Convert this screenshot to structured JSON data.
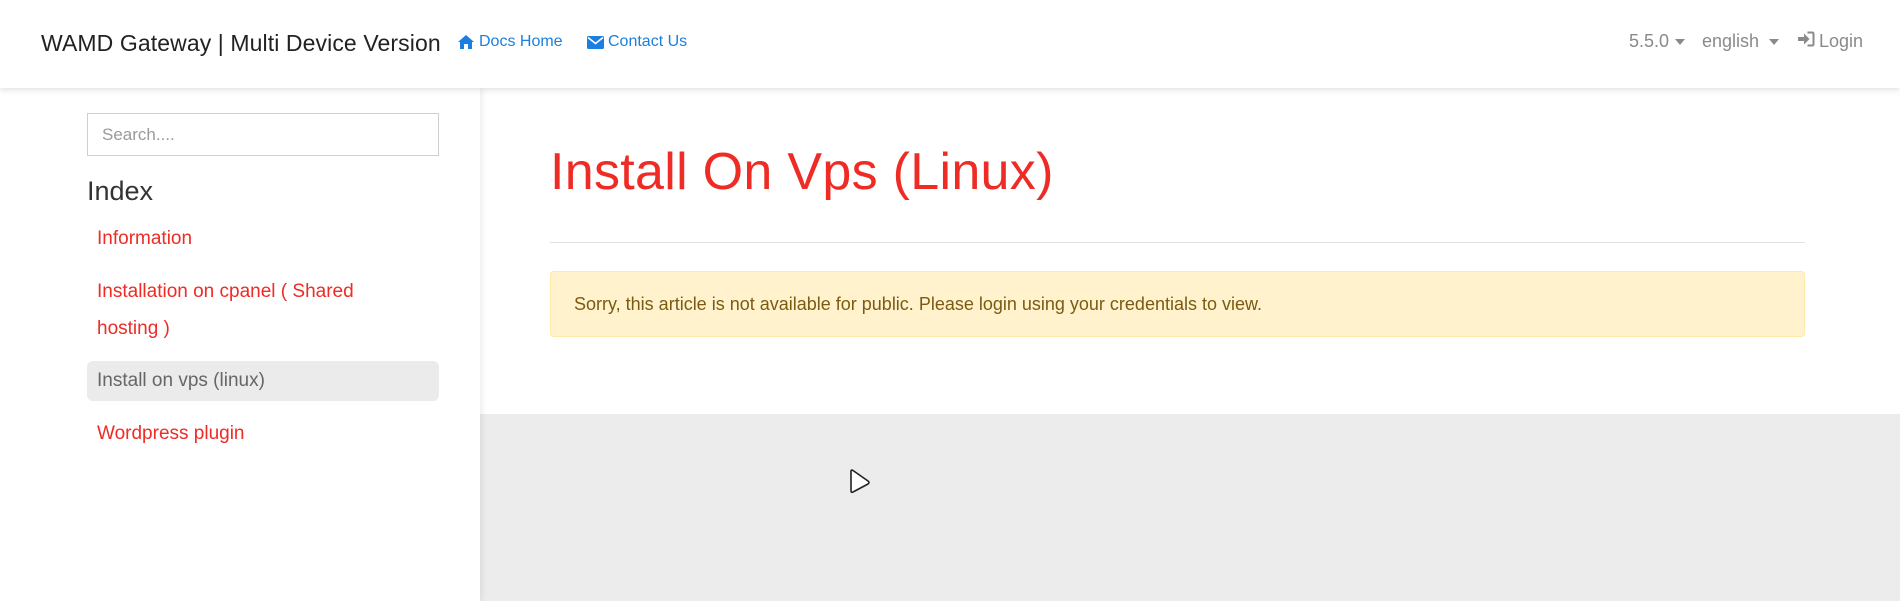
{
  "navbar": {
    "brand": "WAMD Gateway | Multi Device Version",
    "links": [
      {
        "label": "Docs Home",
        "icon": "home-icon"
      },
      {
        "label": "Contact Us",
        "icon": "envelope-icon"
      }
    ],
    "version_label": "5.5.0",
    "language_label": "english",
    "login_label": "Login",
    "accent_color": "#1a7fe0"
  },
  "sidebar": {
    "search_placeholder": "Search....",
    "search_value": "",
    "index_title": "Index",
    "items": [
      {
        "label": "Information",
        "active": false
      },
      {
        "label": "Installation on cpanel ( Shared hosting )",
        "active": false
      },
      {
        "label": "Install on vps (linux)",
        "active": true
      },
      {
        "label": "Wordpress plugin",
        "active": false
      }
    ],
    "link_color": "#ee2b24"
  },
  "main": {
    "title": "Install On Vps (Linux)",
    "alert_text": "Sorry, this article is not available for public. Please login using your credentials to view.",
    "alert_bg": "#fff2cc"
  }
}
